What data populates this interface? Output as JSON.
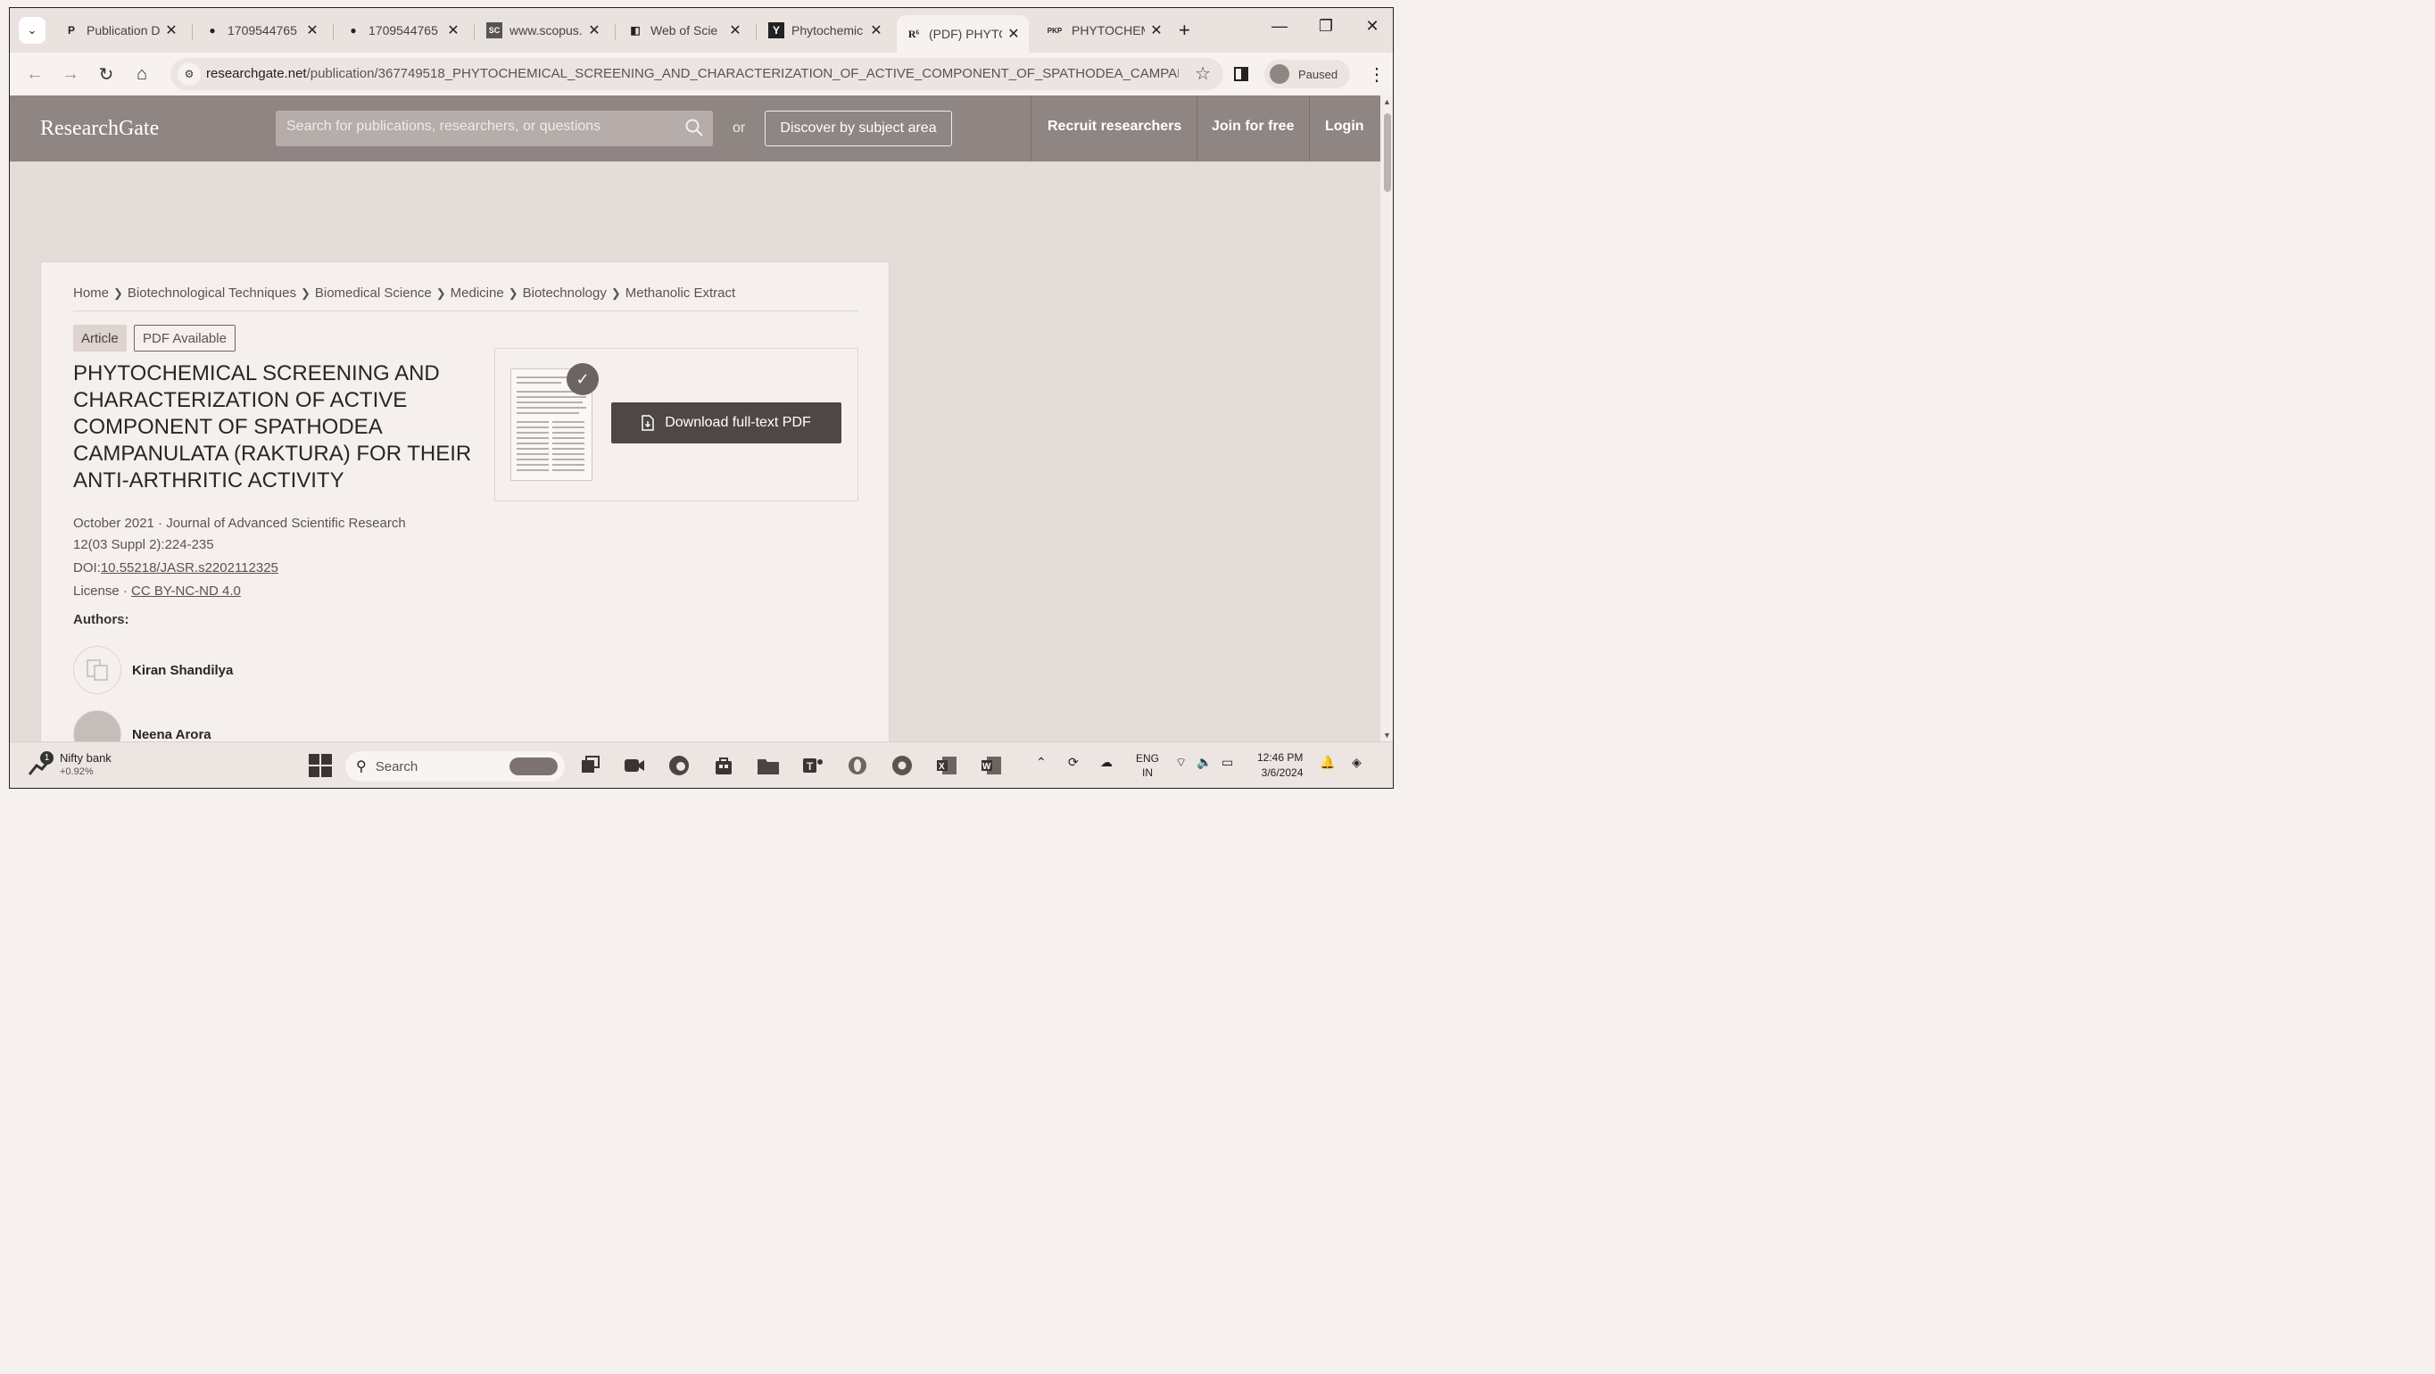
{
  "browser": {
    "tabs": [
      {
        "label": "Publication D",
        "favicon": "P"
      },
      {
        "label": "1709544765",
        "favicon": "●"
      },
      {
        "label": "1709544765",
        "favicon": "●"
      },
      {
        "label": "www.scopus.",
        "favicon": "SC"
      },
      {
        "label": "Web of Scie",
        "favicon": "◧"
      },
      {
        "label": "Phytochemic",
        "favicon": "Y"
      },
      {
        "label": "(PDF) PHYTO",
        "favicon": "R⁶"
      },
      {
        "label": "PHYTOCHEM",
        "favicon": "PKP"
      }
    ],
    "active_tab_index": 6,
    "url_domain": "researchgate.net",
    "url_path": "/publication/367749518_PHYTOCHEMICAL_SCREENING_AND_CHARACTERIZATION_OF_ACTIVE_COMPONENT_OF_SPATHODEA_CAMPAN...",
    "profile_label": "Paused",
    "new_tab": "+",
    "win_min": "—",
    "win_max": "❐",
    "win_close": "✕"
  },
  "rg": {
    "logo": "ResearchGate",
    "search_placeholder": "Search for publications, researchers, or questions",
    "or": "or",
    "discover": "Discover by subject area",
    "recruit": "Recruit researchers",
    "join": "Join for free",
    "login": "Login"
  },
  "article": {
    "breadcrumbs": [
      "Home",
      "Biotechnological Techniques",
      "Biomedical Science",
      "Medicine",
      "Biotechnology",
      "Methanolic Extract"
    ],
    "type_badge": "Article",
    "pdf_badge": "PDF Available",
    "title": "PHYTOCHEMICAL SCREENING AND CHARACTERIZATION OF ACTIVE COMPONENT OF SPATHODEA CAMPANULATA (RAKTURA) FOR THEIR ANTI-ARTHRITIC ACTIVITY",
    "date_journal": "October 2021 · Journal of Advanced Scientific Research",
    "volume": "12(03 Suppl 2):224-235",
    "doi_label": "DOI:",
    "doi": "10.55218/JASR.s2202112325",
    "license_label": "License ·",
    "license": "CC BY-NC-ND 4.0",
    "authors_heading": "Authors:",
    "authors": [
      "Kiran Shandilya",
      "Neena Arora"
    ],
    "download_label": "Download full-text PDF"
  },
  "taskbar": {
    "weather_title": "Nifty bank",
    "weather_change": "+0.92%",
    "weather_badge": "1",
    "search_label": "Search",
    "lang_top": "ENG",
    "lang_bottom": "IN",
    "time": "12:46 PM",
    "date": "3/6/2024"
  }
}
